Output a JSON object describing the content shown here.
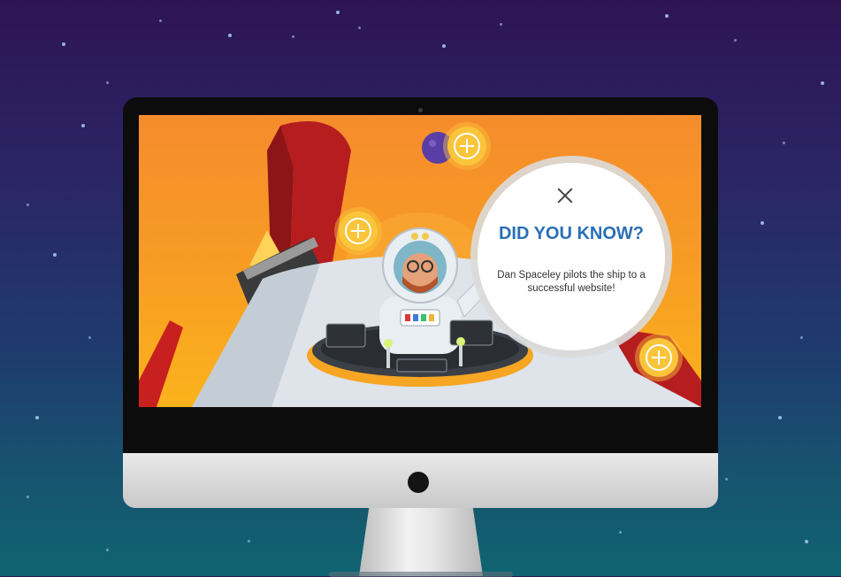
{
  "popup": {
    "title": "DID YOU KNOW?",
    "body": "Dan Spaceley pilots the ship to a successful website!"
  },
  "icons": {
    "close": "close-icon",
    "hotspot": "plus-circle-icon"
  },
  "colors": {
    "accent": "#2a6fb6",
    "hotspot": "#fbc53b",
    "screen_bg": "#f79b25"
  }
}
